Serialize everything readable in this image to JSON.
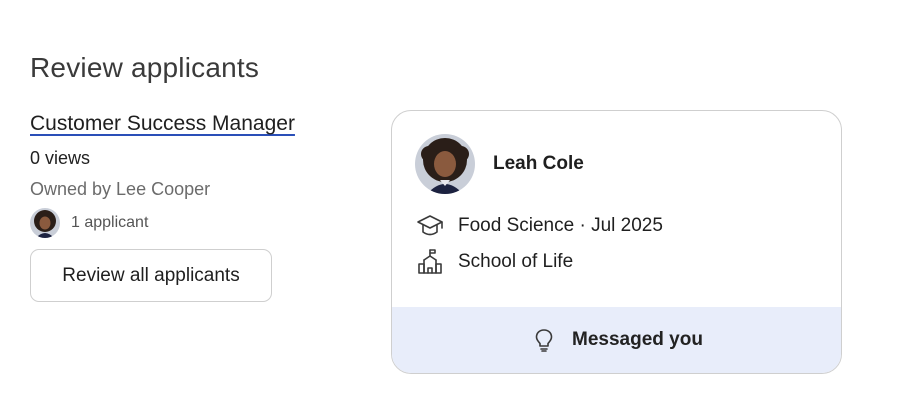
{
  "page": {
    "title": "Review applicants"
  },
  "job": {
    "title": "Customer Success Manager",
    "views": "0 views",
    "owner": "Owned by Lee Cooper",
    "applicants": "1 applicant",
    "review_button": "Review all applicants"
  },
  "candidate": {
    "name": "Leah Cole",
    "education": "Food Science · Jul 2025",
    "school": "School of Life",
    "status": "Messaged you"
  },
  "colors": {
    "footer_bg": "#e8edfa",
    "link_underline": "#2a4fb8"
  },
  "icons": {
    "education": "graduation-cap-icon",
    "school": "school-building-icon",
    "status": "lightbulb-icon"
  }
}
